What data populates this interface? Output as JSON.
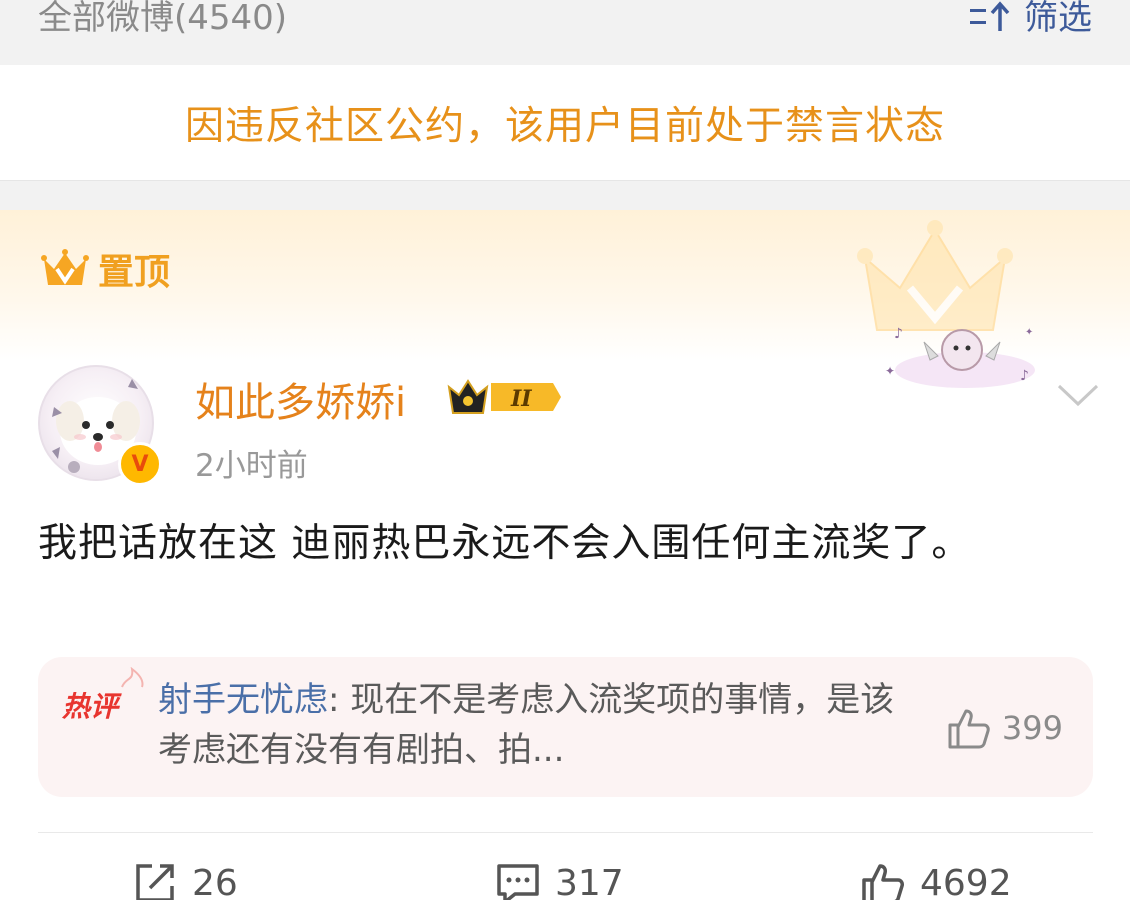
{
  "header": {
    "weibo_count_label": "全部微博(4540)",
    "filter_label": "筛选",
    "filter_icon": "sort-arrow-icon"
  },
  "notice": {
    "text": "因违反社区公约，该用户目前处于禁言状态"
  },
  "post": {
    "pinned_label": "置顶",
    "user": {
      "name": "如此多娇娇i",
      "time": "2小时前",
      "verified_mark": "V",
      "member_badge": "II"
    },
    "content": "我把话放在这 迪丽热巴永远不会入围任何主流奖了。",
    "hot_comment": {
      "tag": "热评",
      "user": "射手无忧虑",
      "separator": ":",
      "text": " 现在不是考虑入流奖项的事情，是该考虑还有没有有剧拍、拍...",
      "likes": "399"
    },
    "actions": {
      "repost_count": "26",
      "comment_count": "317",
      "like_count": "4692"
    }
  },
  "colors": {
    "accent_orange": "#e5821b",
    "notice_orange": "#e7911a",
    "link_blue": "#4a6fa8",
    "hot_red": "#e8352f"
  }
}
